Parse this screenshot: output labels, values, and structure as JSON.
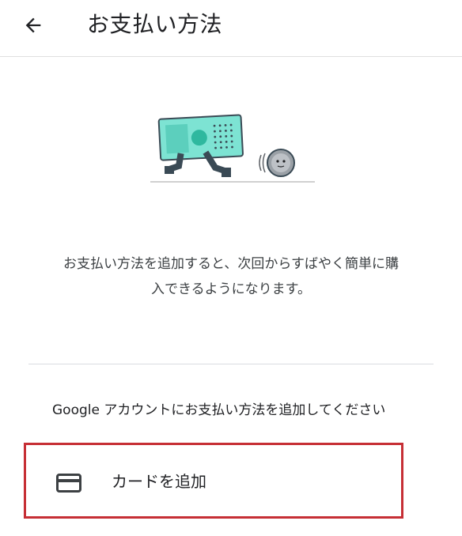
{
  "header": {
    "title": "お支払い方法"
  },
  "empty_state": {
    "description_line1": "お支払い方法を追加すると、次回からすばやく簡単に購",
    "description_line2": "入できるようになります。"
  },
  "section": {
    "label": "Google アカウントにお支払い方法を追加してください"
  },
  "actions": {
    "add_card_label": "カードを追加"
  },
  "colors": {
    "highlight_border": "#c62f35",
    "illustration_teal": "#7de3d3",
    "divider": "#dadce0"
  },
  "icons": {
    "back": "arrow-back-icon",
    "card": "credit-card-icon"
  }
}
